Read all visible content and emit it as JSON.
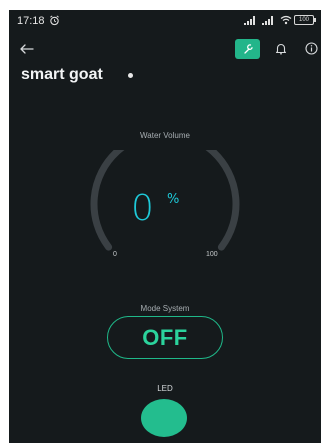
{
  "status_bar": {
    "time": "17:18",
    "battery": "100"
  },
  "header": {
    "device_name": "smart goat"
  },
  "gauge": {
    "label": "Water Volume",
    "value": "0",
    "unit": "%",
    "min_label": "0",
    "max_label": "100",
    "level_fraction": 0
  },
  "mode": {
    "label": "Mode System",
    "state": "OFF"
  },
  "led": {
    "label": "LED"
  },
  "colors": {
    "background": "#151a1c",
    "accent": "#23b58a",
    "gauge_value": "#1ec9d8",
    "track": "#3a4044"
  },
  "icons": [
    "alarm-icon",
    "signal-icon",
    "wifi-icon",
    "battery-icon",
    "back-arrow-icon",
    "wrench-icon",
    "bell-icon",
    "info-icon"
  ]
}
